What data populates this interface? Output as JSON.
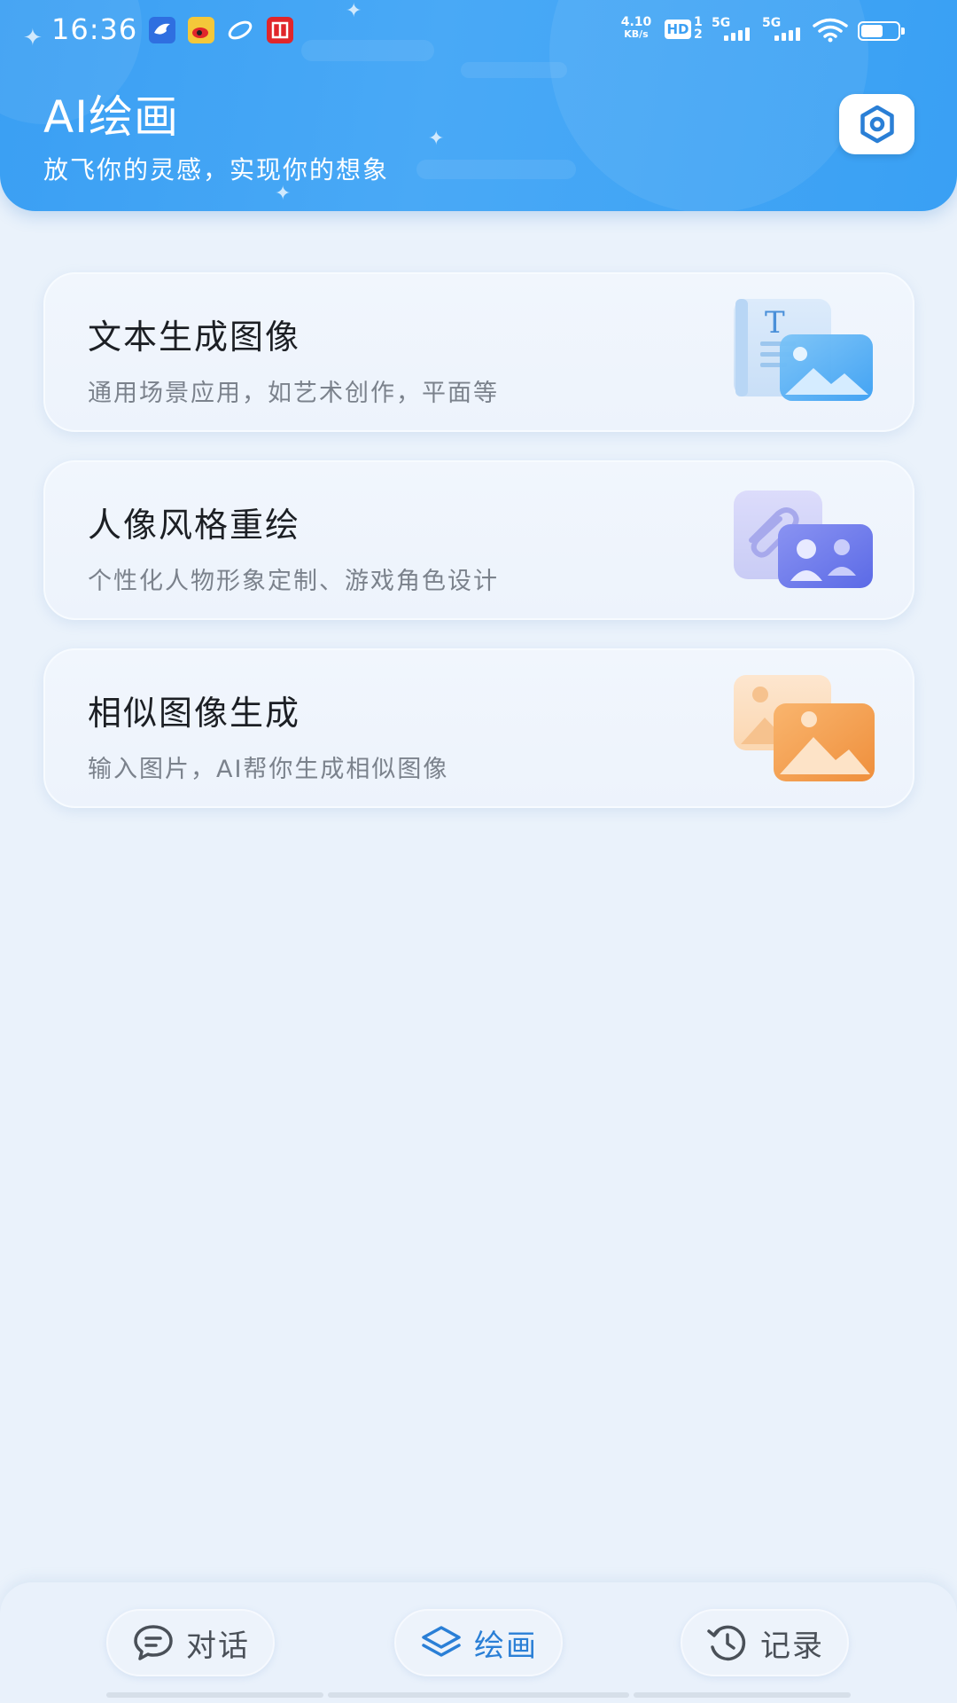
{
  "status_bar": {
    "time": "16:36",
    "net_speed_value": "4.10",
    "net_speed_unit": "KB/s",
    "hd_label": "HD",
    "hd_sim": "1 2",
    "signal1_label": "5G",
    "signal2_label": "5G",
    "battery_level": 0.6,
    "notif_icons": [
      "bird-app-icon",
      "weibo-icon",
      "link-app-icon",
      "citic-app-icon"
    ]
  },
  "header": {
    "title": "AI绘画",
    "subtitle": "放飞你的灵感，实现你的想象",
    "settings_icon": "settings-hexagon-icon"
  },
  "cards": [
    {
      "title": "文本生成图像",
      "desc": "通用场景应用，如艺术创作，平面等",
      "icon": "text-to-image-icon"
    },
    {
      "title": "人像风格重绘",
      "desc": "个性化人物形象定制、游戏角色设计",
      "icon": "portrait-restyle-icon"
    },
    {
      "title": "相似图像生成",
      "desc": "输入图片，AI帮你生成相似图像",
      "icon": "similar-image-icon"
    }
  ],
  "bottom_nav": [
    {
      "label": "对话",
      "icon": "chat-icon",
      "active": false
    },
    {
      "label": "绘画",
      "icon": "layers-icon",
      "active": true
    },
    {
      "label": "记录",
      "icon": "history-icon",
      "active": false
    }
  ],
  "colors": {
    "header_blue": "#3a9ff3",
    "page_bg": "#eaf2fb",
    "active_nav": "#2a7fd6",
    "title_text": "#1c1f24",
    "desc_text": "#7b828c"
  }
}
